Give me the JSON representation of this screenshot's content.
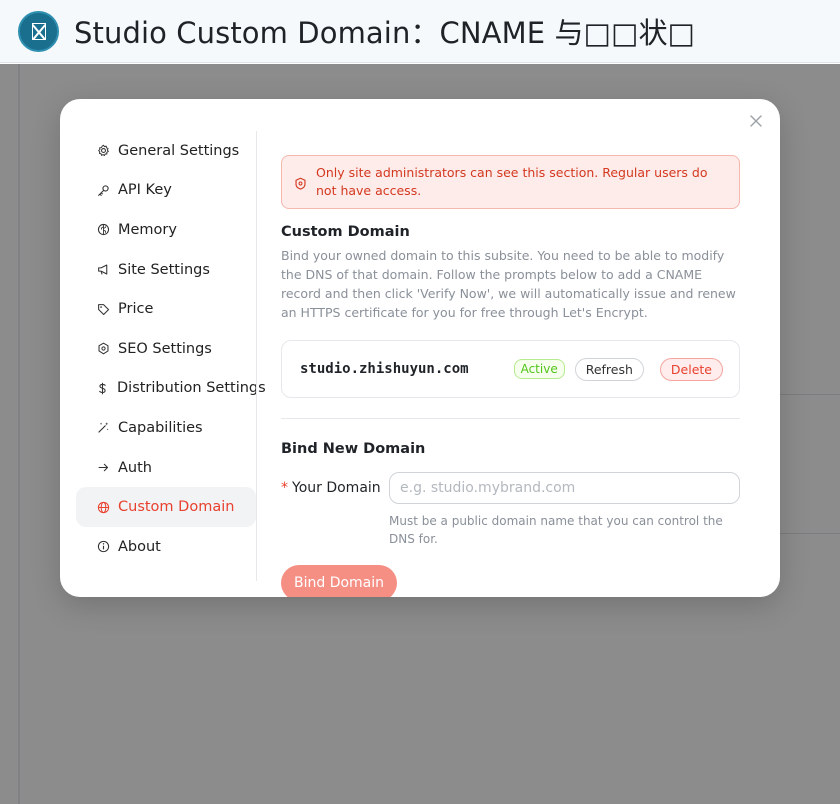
{
  "window": {
    "title": "Studio Custom Domain：CNAME 与□□状□",
    "icon": "app-logo-icon"
  },
  "modal": {
    "close_icon": "close-icon",
    "nav": [
      {
        "label": "General Settings",
        "icon": "gear-icon"
      },
      {
        "label": "API Key",
        "icon": "key-icon"
      },
      {
        "label": "Memory",
        "icon": "brain-icon"
      },
      {
        "label": "Site Settings",
        "icon": "megaphone-icon"
      },
      {
        "label": "Price",
        "icon": "tag-icon"
      },
      {
        "label": "SEO Settings",
        "icon": "shield-gear-icon"
      },
      {
        "label": "Distribution Settings",
        "icon": "dollar-icon"
      },
      {
        "label": "Capabilities",
        "icon": "magic-wand-icon"
      },
      {
        "label": "Auth",
        "icon": "arrow-right-icon"
      },
      {
        "label": "Custom Domain",
        "icon": "globe-icon",
        "active": true
      },
      {
        "label": "About",
        "icon": "info-icon"
      }
    ],
    "alert": {
      "icon": "shield-alert-icon",
      "text": "Only site administrators can see this section. Regular users do not have access."
    },
    "custom_domain": {
      "title": "Custom Domain",
      "description": "Bind your owned domain to this subsite. You need to be able to modify the DNS of that domain. Follow the prompts below to add a CNAME record and then click 'Verify Now', we will automatically issue and renew an HTTPS certificate for you for free through Let's Encrypt.",
      "domain": "studio.zhishuyun.com",
      "status": "Active",
      "refresh_label": "Refresh",
      "delete_label": "Delete"
    },
    "bind_new": {
      "title": "Bind New Domain",
      "required_mark": "*",
      "label": "Your Domain",
      "placeholder": "e.g. studio.mybrand.com",
      "value": "",
      "hint": "Must be a public domain name that you can control the DNS for.",
      "submit_label": "Bind Domain"
    }
  },
  "colors": {
    "accent": "#e8412e",
    "primary_button": "#f58f84",
    "success": "#52c41a",
    "alert_bg": "#fdecea"
  }
}
